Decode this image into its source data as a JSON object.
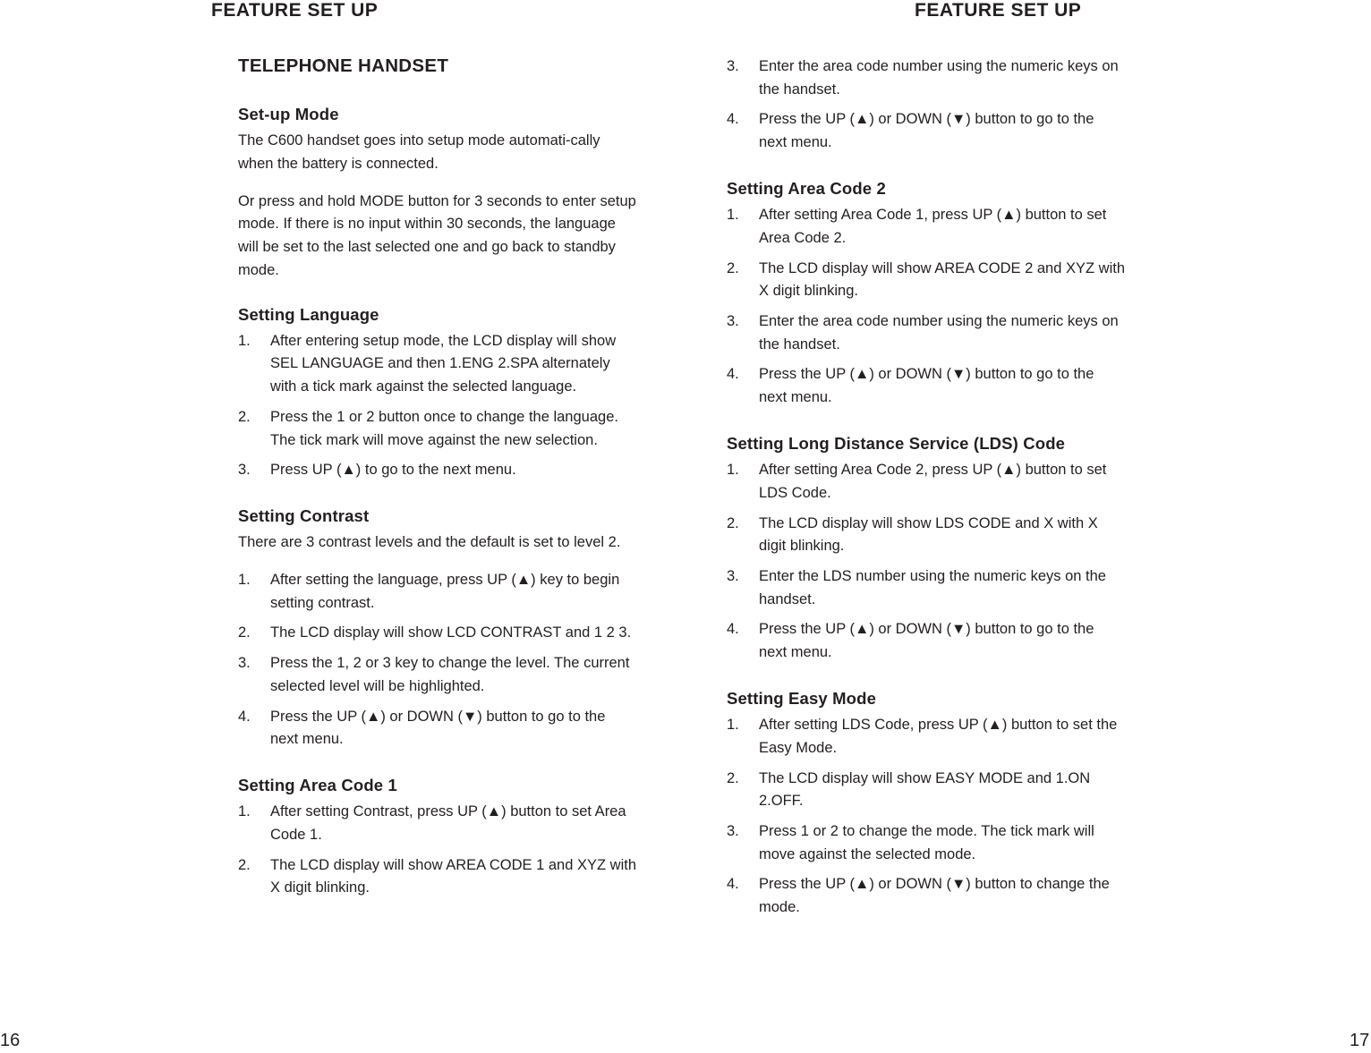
{
  "left_page": {
    "running_head": "FEATURE SET UP",
    "folio": "16",
    "section_title": "TELEPHONE HANDSET",
    "blocks": [
      {
        "heading": "Set-up Mode",
        "paragraphs": [
          "The C600 handset goes into setup mode automati-cally when the battery is connected.",
          "Or press and hold MODE button for 3 seconds to enter setup mode. If there is no input within 30 seconds, the language will be set to the last selected one and go back to standby mode."
        ]
      },
      {
        "heading": "Setting Language",
        "steps": [
          {
            "num": "1.",
            "text": "After entering setup mode, the LCD display will show SEL LANGUAGE and then 1.ENG 2.SPA alternately with a tick mark against the selected language."
          },
          {
            "num": "2.",
            "text": "Press the 1 or 2 button once to change the language. The tick mark will move against the new selection."
          },
          {
            "num": "3.",
            "text": "Press UP (▲) to go to the next menu."
          }
        ]
      },
      {
        "heading": "Setting Contrast",
        "paragraphs": [
          "There are 3 contrast levels and the default is set to level 2."
        ],
        "steps": [
          {
            "num": "1.",
            "text": "After setting the language, press UP (▲) key to begin setting contrast."
          },
          {
            "num": "2.",
            "text": "The LCD display will show LCD CONTRAST and 1  2  3."
          },
          {
            "num": "3.",
            "text": "Press the 1, 2 or 3 key to change the level. The current selected level will be highlighted."
          },
          {
            "num": "4.",
            "text": "Press the UP (▲) or DOWN (▼) button to go to the next menu."
          }
        ]
      },
      {
        "heading": "Setting Area Code 1",
        "steps": [
          {
            "num": "1.",
            "text": "After setting Contrast, press UP (▲) button to set Area Code 1."
          },
          {
            "num": "2.",
            "text": "The LCD display will show AREA CODE 1 and XYZ with X digit blinking."
          }
        ]
      }
    ]
  },
  "right_page": {
    "running_head": "FEATURE SET UP",
    "folio": "17",
    "blocks": [
      {
        "heading": "",
        "steps": [
          {
            "num": "3.",
            "text": "Enter the area code number using the numeric keys on the handset."
          },
          {
            "num": "4.",
            "text": "Press the UP (▲) or DOWN (▼) button to go to the next menu."
          }
        ]
      },
      {
        "heading": "Setting Area Code 2",
        "steps": [
          {
            "num": "1.",
            "text": "After setting Area Code 1, press UP (▲) button to set Area Code 2."
          },
          {
            "num": "2.",
            "text": "The LCD display will show AREA CODE 2 and XYZ with X digit blinking."
          },
          {
            "num": "3.",
            "text": "Enter the area code number using the numeric keys on the handset."
          },
          {
            "num": "4.",
            "text": "Press the UP (▲) or DOWN (▼) button to go to the next menu."
          }
        ]
      },
      {
        "heading": "Setting Long Distance Service (LDS) Code",
        "steps": [
          {
            "num": "1.",
            "text": "After setting Area Code 2, press UP (▲) button to set LDS Code."
          },
          {
            "num": "2.",
            "text": "The LCD display will show LDS CODE and X with X digit blinking."
          },
          {
            "num": "3.",
            "text": "Enter the LDS number using the numeric keys on the handset."
          },
          {
            "num": "4.",
            "text": "Press the UP (▲) or DOWN (▼) button to go to the next menu."
          }
        ]
      },
      {
        "heading": "Setting Easy Mode",
        "steps": [
          {
            "num": "1.",
            "text": "After setting LDS Code, press UP (▲) button to set the Easy Mode."
          },
          {
            "num": "2.",
            "text": "The LCD display will show EASY MODE and 1.ON  2.OFF."
          },
          {
            "num": "3.",
            "text": "Press 1 or 2 to change the mode. The tick mark will move against the selected mode."
          },
          {
            "num": "4.",
            "text": "Press the UP (▲) or DOWN (▼) button to change the mode."
          }
        ]
      }
    ]
  }
}
